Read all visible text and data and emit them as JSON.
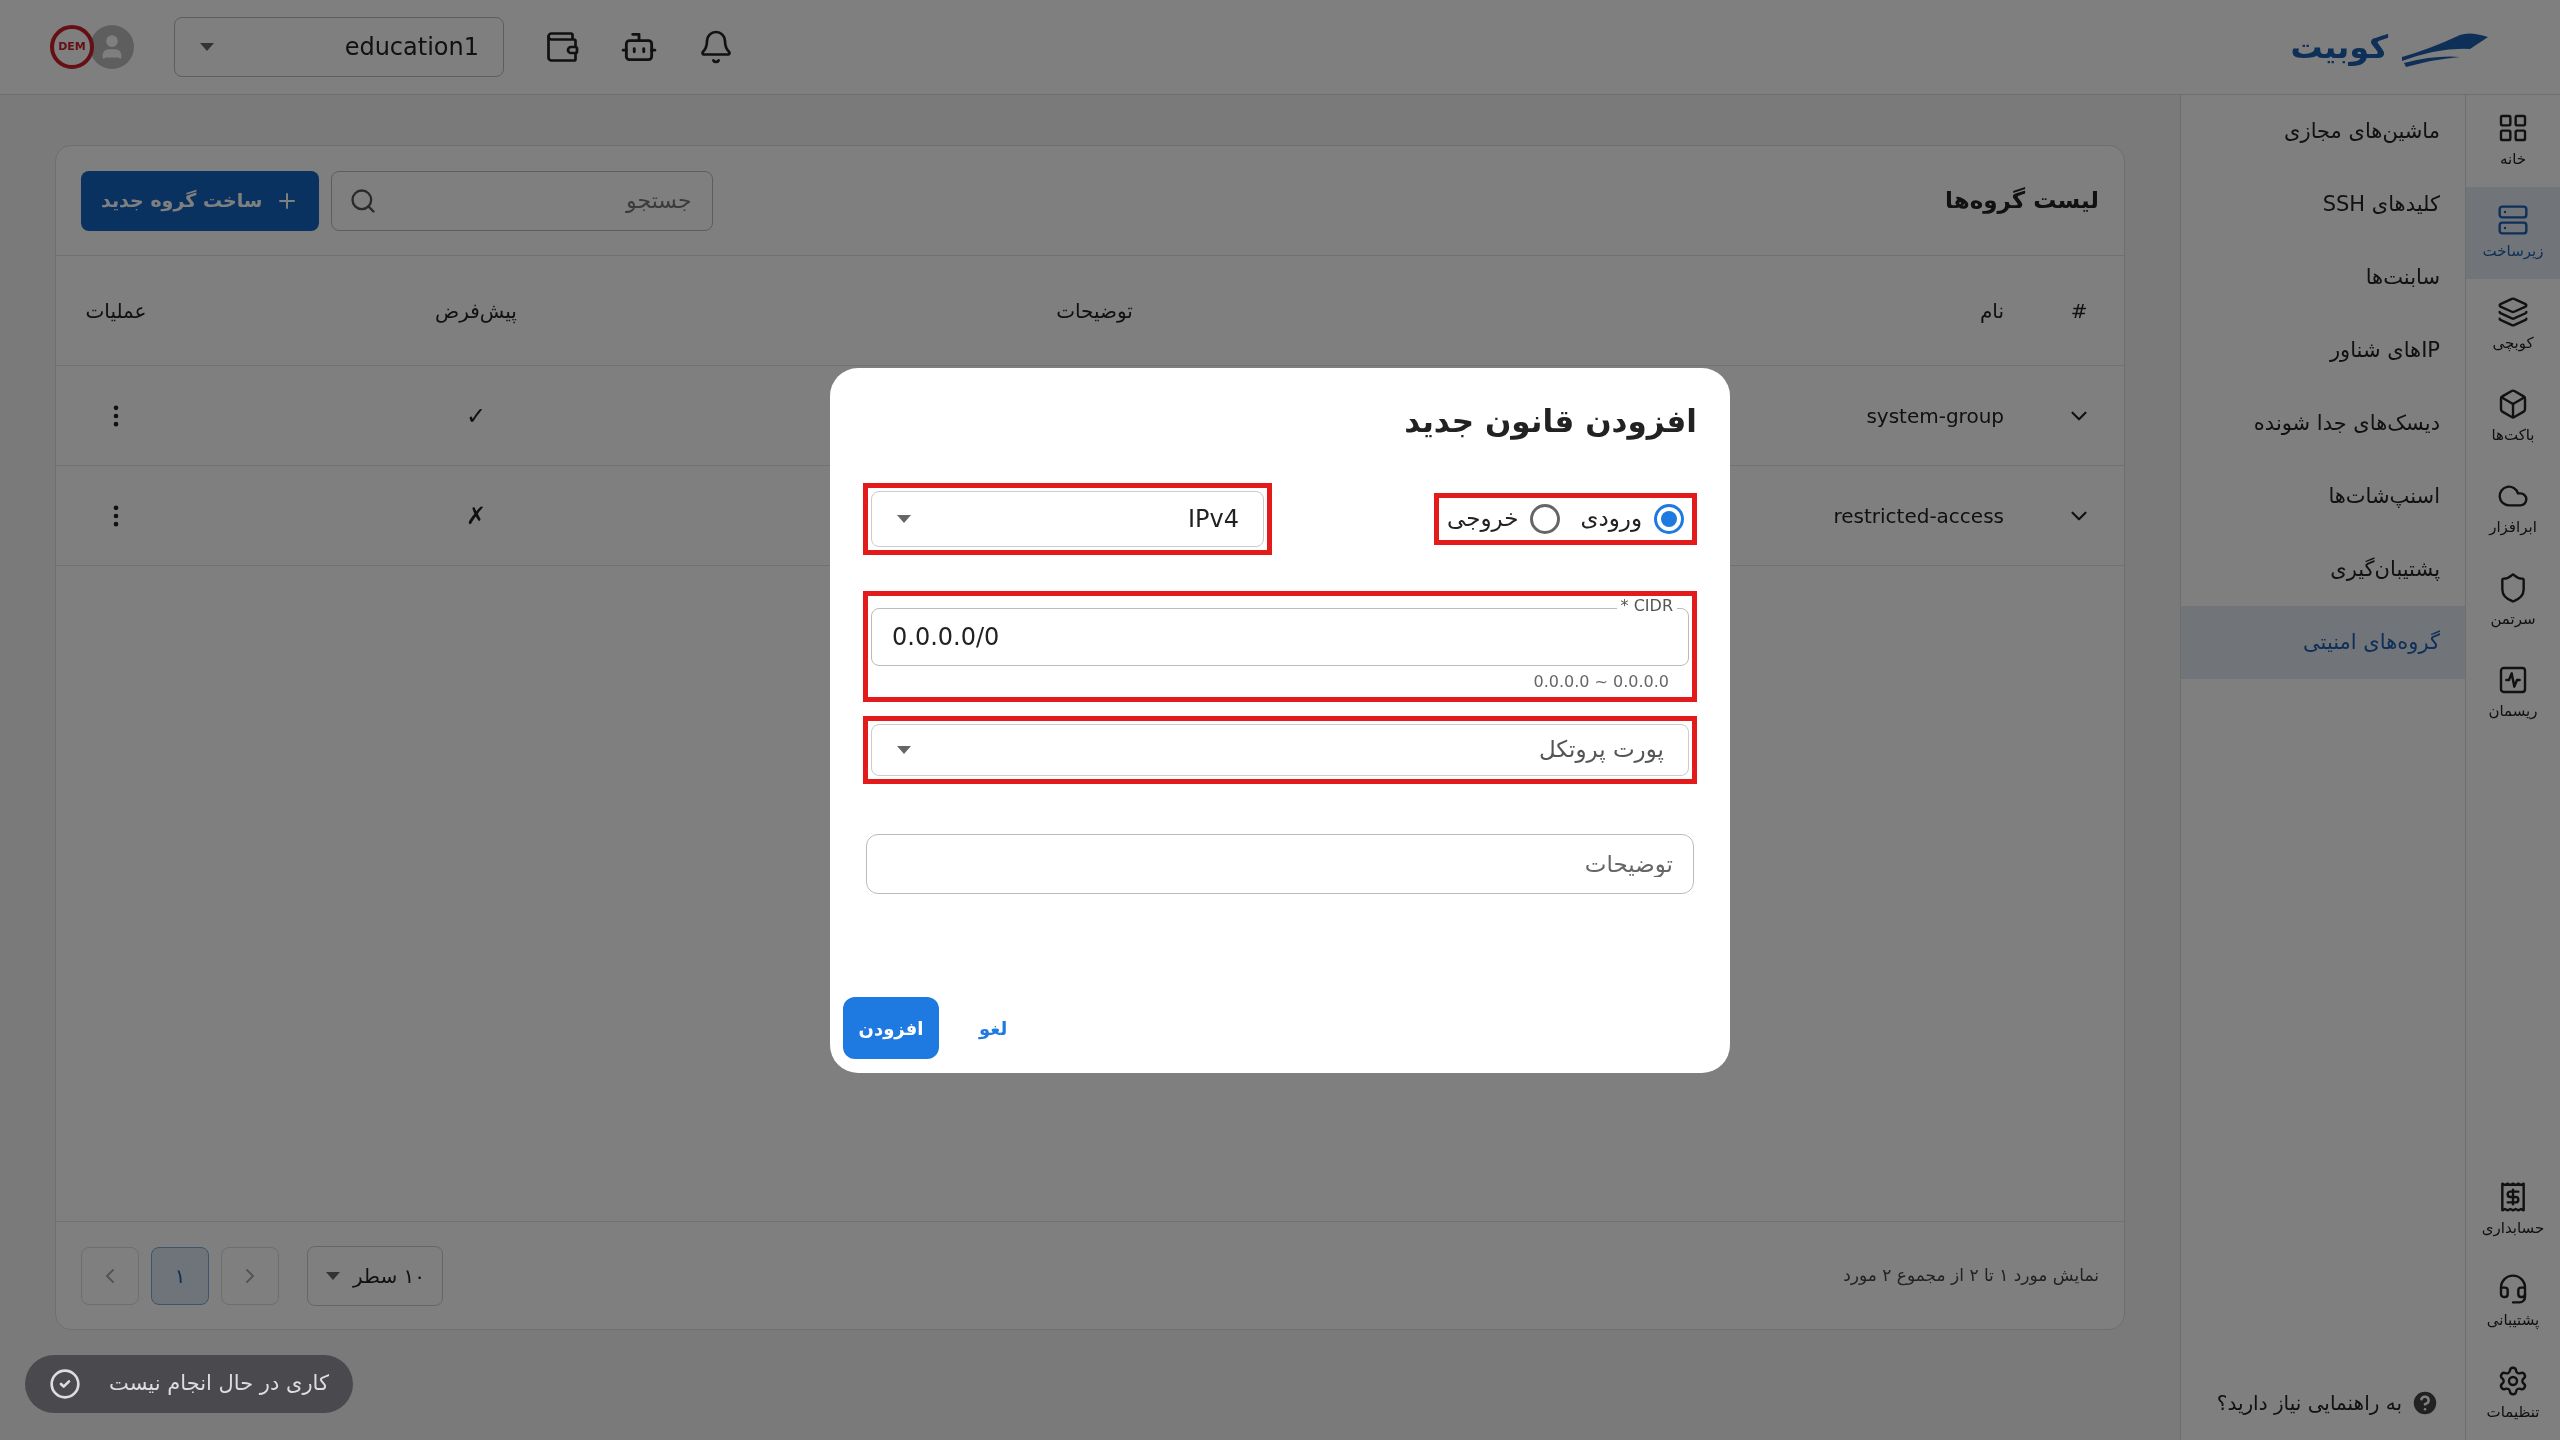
{
  "header": {
    "logo_text": "کوبیت",
    "stamp_text": "DEM",
    "workspace": "education1"
  },
  "rail": {
    "items": [
      {
        "label": "خانه",
        "kind": "grid",
        "selected": false
      },
      {
        "label": "زیرساخت",
        "kind": "server",
        "selected": true
      },
      {
        "label": "کوبچی",
        "kind": "layers",
        "selected": false
      },
      {
        "label": "باکت‌ها",
        "kind": "box",
        "selected": false
      },
      {
        "label": "ابرافزار",
        "kind": "cloud",
        "selected": false
      },
      {
        "label": "سرتمن",
        "kind": "shield",
        "selected": false
      },
      {
        "label": "ریسمان",
        "kind": "activity",
        "selected": false
      }
    ],
    "bottom_items": [
      {
        "label": "حسابداری",
        "kind": "receipt",
        "selected": false
      },
      {
        "label": "پشتیبانی",
        "kind": "headset",
        "selected": false
      },
      {
        "label": "تنظیمات",
        "kind": "settings",
        "selected": false
      }
    ]
  },
  "sidebar": {
    "items": [
      {
        "label": "ماشین‌های مجازی",
        "selected": false
      },
      {
        "label": "کلیدهای SSH",
        "selected": false
      },
      {
        "label": "سابنت‌ها",
        "selected": false
      },
      {
        "label": "IPهای شناور",
        "selected": false
      },
      {
        "label": "دیسک‌های جدا شونده",
        "selected": false
      },
      {
        "label": "اسنپ‌شات‌ها",
        "selected": false
      },
      {
        "label": "پشتیبان‌گیری",
        "selected": false
      },
      {
        "label": "گروه‌های امنیتی",
        "selected": true
      }
    ],
    "help": "به راهنمایی نیاز دارید؟"
  },
  "page": {
    "title": "لیست گروه‌ها",
    "search": {
      "placeholder": "جستجو"
    },
    "create_button": "ساخت گروه جدید",
    "table": {
      "columns": [
        "#",
        "نام",
        "توضیحات",
        "پیش‌فرض",
        "عملیات"
      ],
      "rows": [
        {
          "name": "system-group",
          "default": "✓"
        },
        {
          "name": "restricted-access",
          "default": "✗"
        }
      ]
    },
    "footer": {
      "summary": "نمایش مورد ۱ تا ۲ از مجموع ۲ مورد",
      "page_size": "۱۰ سطر",
      "pages": [
        {
          "label": "۱",
          "selected": true
        }
      ]
    }
  },
  "status": "کاری در حال انجام نیست",
  "modal": {
    "title": "افزودن قانون جدید",
    "direction": [
      {
        "label": "ورودی",
        "selected": true
      },
      {
        "label": "خروجی",
        "selected": false
      }
    ],
    "ip_version": {
      "value": "IPv4"
    },
    "cidr": {
      "label": "CIDR *",
      "value": "0.0.0.0/0",
      "helper": "0.0.0.0 ~ 0.0.0.0"
    },
    "port_protocol": {
      "placeholder": "پورت پروتکل"
    },
    "description": {
      "placeholder": "توضیحات"
    },
    "buttons": {
      "submit": "افزودن",
      "cancel": "لغو"
    }
  }
}
